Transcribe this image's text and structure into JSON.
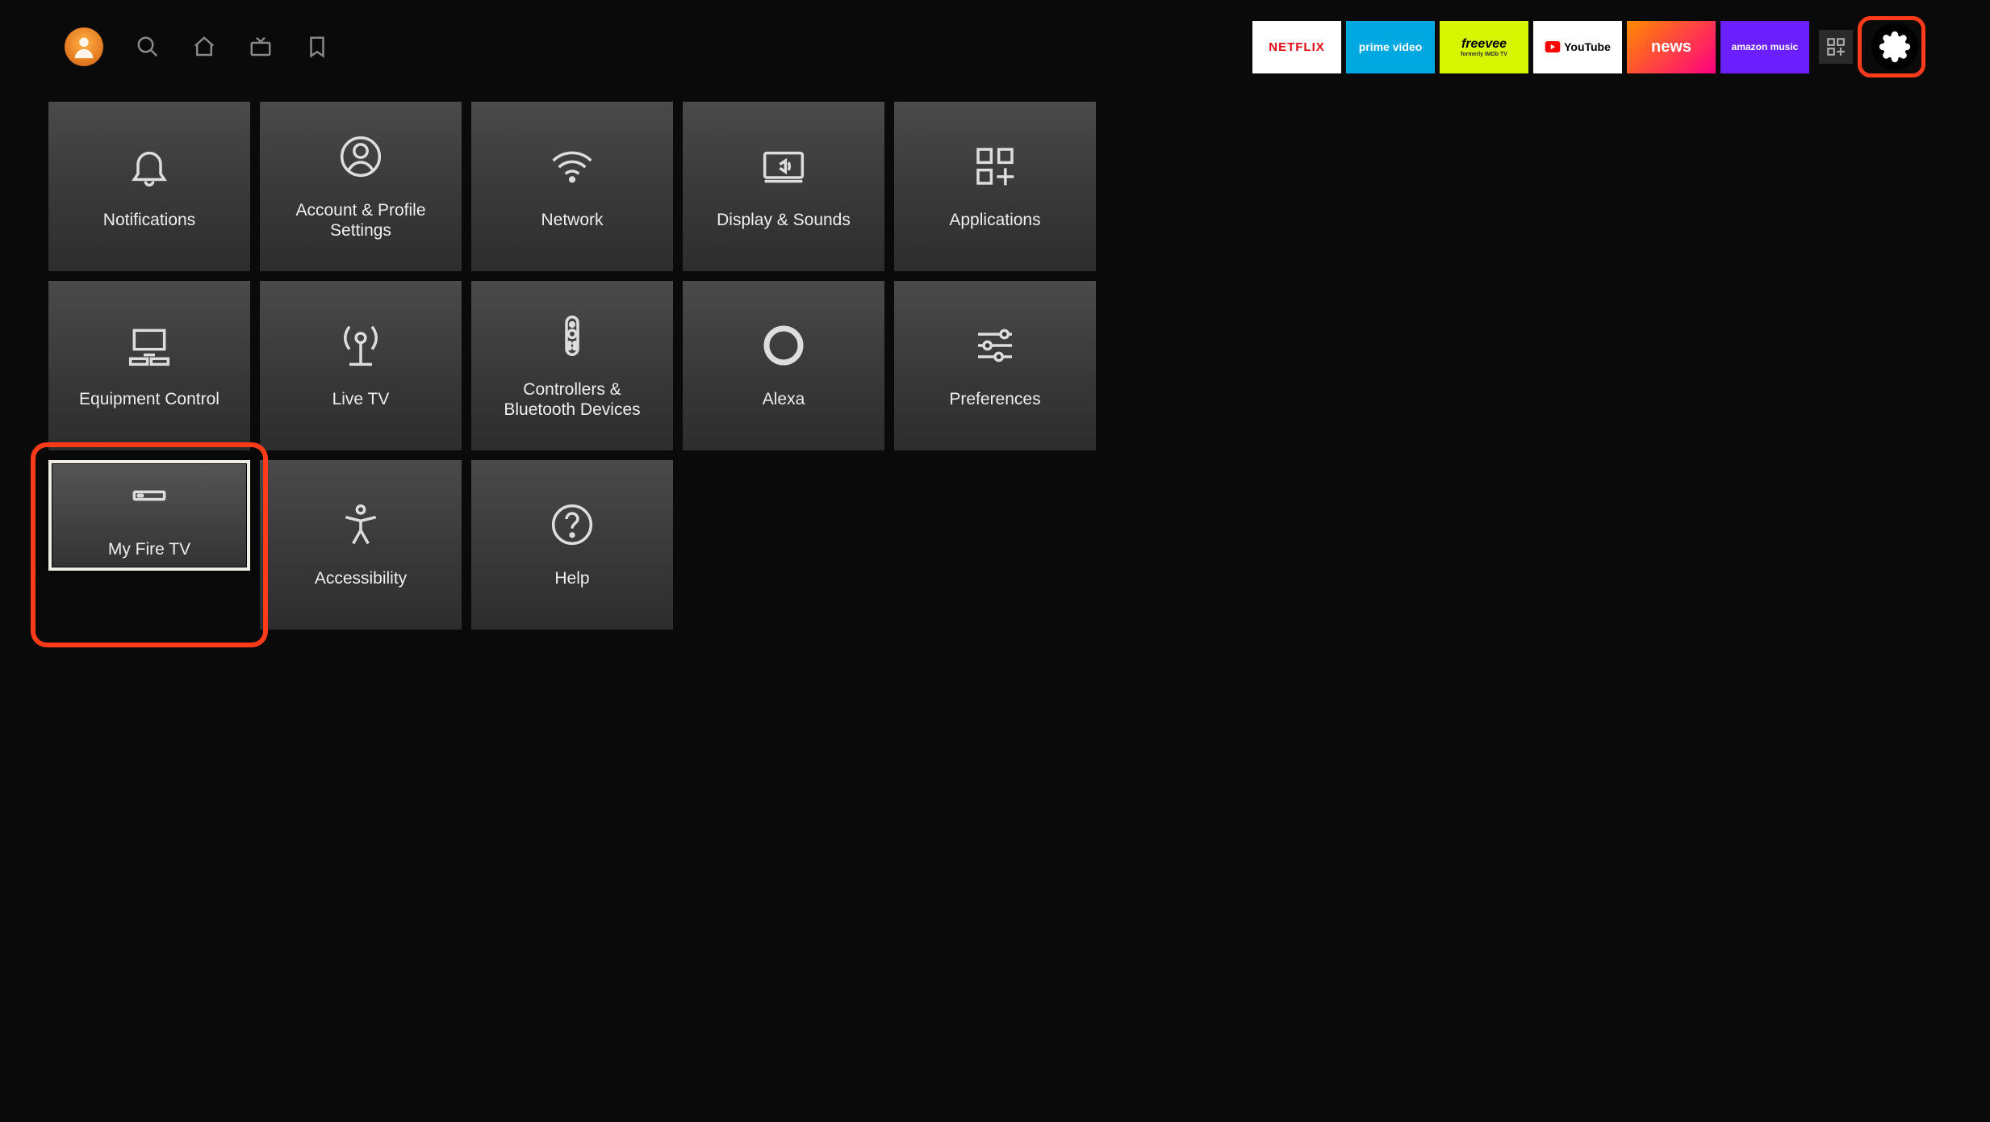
{
  "nav": {
    "apps": [
      {
        "id": "netflix",
        "label": "NETFLIX"
      },
      {
        "id": "primevideo",
        "label": "prime video"
      },
      {
        "id": "freevee",
        "label": "freevee",
        "sublabel": "formerly IMDb TV"
      },
      {
        "id": "youtube",
        "label": "YouTube"
      },
      {
        "id": "news",
        "label": "news"
      },
      {
        "id": "amazonmusic",
        "label": "amazon music"
      }
    ]
  },
  "settings": {
    "tiles": [
      {
        "id": "notifications",
        "label": "Notifications",
        "icon": "bell-icon"
      },
      {
        "id": "account",
        "label": "Account & Profile Settings",
        "icon": "user-icon"
      },
      {
        "id": "network",
        "label": "Network",
        "icon": "wifi-icon"
      },
      {
        "id": "display",
        "label": "Display & Sounds",
        "icon": "monitor-sound-icon"
      },
      {
        "id": "applications",
        "label": "Applications",
        "icon": "apps-icon"
      },
      {
        "id": "equipment",
        "label": "Equipment Control",
        "icon": "equipment-icon"
      },
      {
        "id": "livetv",
        "label": "Live TV",
        "icon": "antenna-icon"
      },
      {
        "id": "controllers",
        "label": "Controllers & Bluetooth Devices",
        "icon": "remote-icon"
      },
      {
        "id": "alexa",
        "label": "Alexa",
        "icon": "alexa-icon"
      },
      {
        "id": "preferences",
        "label": "Preferences",
        "icon": "sliders-icon"
      },
      {
        "id": "myfiretv",
        "label": "My Fire TV",
        "icon": "device-icon",
        "selected": true
      },
      {
        "id": "accessibility",
        "label": "Accessibility",
        "icon": "accessibility-icon"
      },
      {
        "id": "help",
        "label": "Help",
        "icon": "question-icon"
      }
    ]
  },
  "highlights": {
    "settings_button": true,
    "selected_tile": "myfiretv"
  }
}
